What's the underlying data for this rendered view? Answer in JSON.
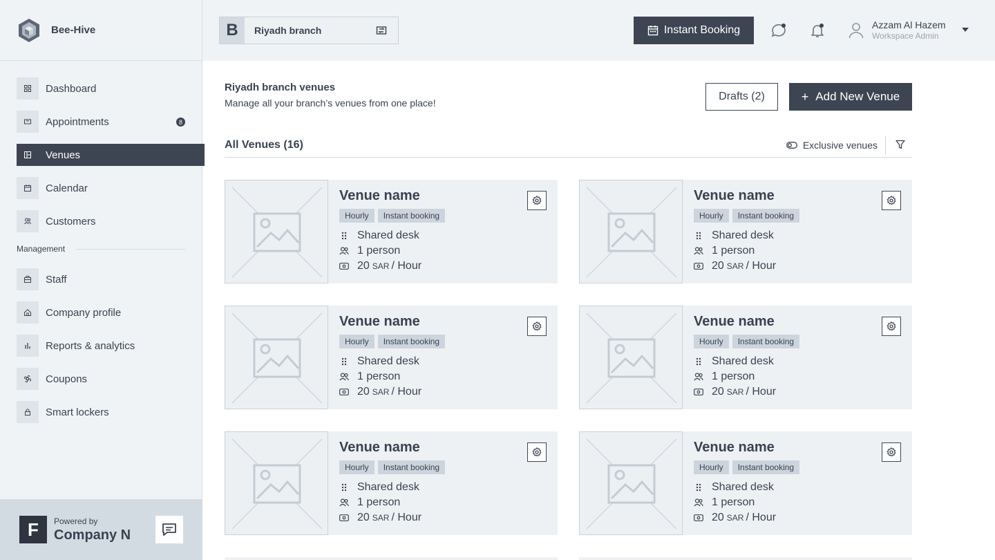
{
  "brand": {
    "name": "Bee-Hive"
  },
  "nav": {
    "items": [
      {
        "label": "Dashboard",
        "icon": "grid-icon"
      },
      {
        "label": "Appointments",
        "icon": "ticket-icon",
        "badge": "8"
      },
      {
        "label": "Venues",
        "icon": "venue-icon",
        "active": true
      },
      {
        "label": "Calendar",
        "icon": "calendar-icon"
      },
      {
        "label": "Customers",
        "icon": "users-icon"
      }
    ],
    "section_label": "Management",
    "management_items": [
      {
        "label": "Staff",
        "icon": "staff-icon"
      },
      {
        "label": "Company profile",
        "icon": "home-icon"
      },
      {
        "label": "Reports & analytics",
        "icon": "bar-chart-icon"
      },
      {
        "label": "Coupons",
        "icon": "command-icon"
      },
      {
        "label": "Smart lockers",
        "icon": "lock-icon"
      }
    ]
  },
  "footer": {
    "powered_by": "Powered by",
    "company": "Company N",
    "logo_letter": "F"
  },
  "topbar": {
    "branch_letter": "B",
    "branch_name": "Riyadh branch",
    "instant_booking": "Instant Booking",
    "user_name": "Azzam Al Hazem",
    "user_role": "Workspace Admin"
  },
  "main": {
    "title": "Riyadh branch venues",
    "subtitle": "Manage all your branch’s venues from one place!",
    "drafts": "Drafts (2)",
    "add_venue": "Add New Venue",
    "all_venues": "All Venues (16)",
    "exclusive": "Exclusive venues"
  },
  "venues": [
    {
      "name": "Venue name",
      "tags": [
        "Hourly",
        "Instant booking"
      ],
      "type": "Shared desk",
      "capacity": "1 person",
      "price": "20",
      "currency": "SAR",
      "per": "/ Hour"
    },
    {
      "name": "Venue name",
      "tags": [
        "Hourly",
        "Instant booking"
      ],
      "type": "Shared desk",
      "capacity": "1 person",
      "price": "20",
      "currency": "SAR",
      "per": "/ Hour"
    },
    {
      "name": "Venue name",
      "tags": [
        "Hourly",
        "Instant booking"
      ],
      "type": "Shared desk",
      "capacity": "1 person",
      "price": "20",
      "currency": "SAR",
      "per": "/ Hour"
    },
    {
      "name": "Venue name",
      "tags": [
        "Hourly",
        "Instant booking"
      ],
      "type": "Shared desk",
      "capacity": "1 person",
      "price": "20",
      "currency": "SAR",
      "per": "/ Hour"
    },
    {
      "name": "Venue name",
      "tags": [
        "Hourly",
        "Instant booking"
      ],
      "type": "Shared desk",
      "capacity": "1 person",
      "price": "20",
      "currency": "SAR",
      "per": "/ Hour"
    },
    {
      "name": "Venue name",
      "tags": [
        "Hourly",
        "Instant booking"
      ],
      "type": "Shared desk",
      "capacity": "1 person",
      "price": "20",
      "currency": "SAR",
      "per": "/ Hour"
    }
  ],
  "colors": {
    "accent": "#3d4553",
    "surface": "#f0f3f5",
    "card": "#eef1f4",
    "tag": "#ccd5dd"
  }
}
